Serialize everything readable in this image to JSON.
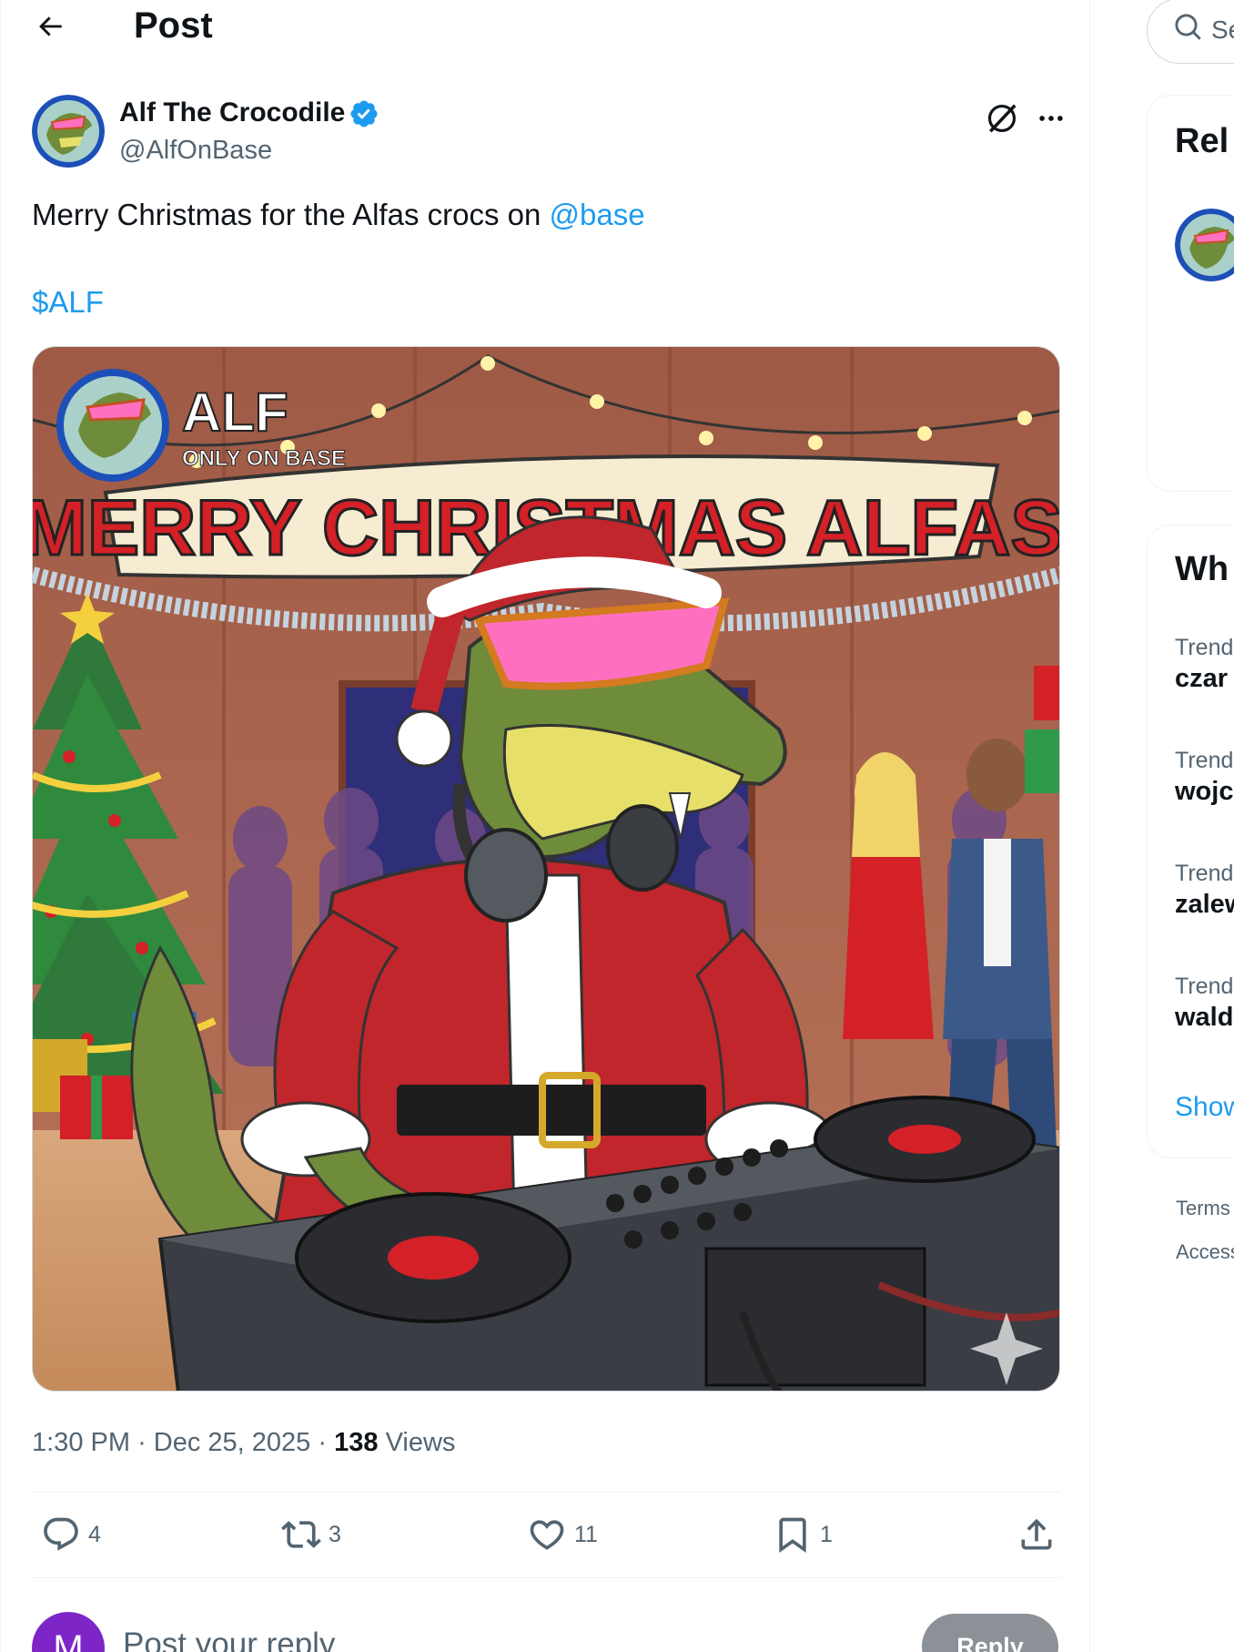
{
  "header": {
    "title": "Post"
  },
  "author": {
    "display_name": "Alf The Crocodile",
    "handle": "@AlfOnBase"
  },
  "post": {
    "text": "Merry Christmas for the Alfas crocs on ",
    "mention": "@base",
    "cashtag": "$ALF",
    "image": {
      "logo_title": "ALF",
      "logo_subtitle": "ONLY ON BASE",
      "banner": "MERRY CHRISTMAS ALFAS"
    },
    "time": "1:30 PM",
    "date": "Dec 25, 2025",
    "views_count": "138",
    "views_label": "Views",
    "separator": "·"
  },
  "actions": {
    "replies": "4",
    "reposts": "3",
    "likes": "11",
    "bookmarks": "1"
  },
  "reply": {
    "avatar_initial": "M",
    "placeholder": "Post your reply",
    "button": "Reply"
  },
  "sidebar": {
    "search_placeholder": "Se",
    "relevant_title": "Rel",
    "whats_title": "Wh",
    "trends": [
      {
        "label": "Trend",
        "name": "czar"
      },
      {
        "label": "Trend",
        "name": "wojc"
      },
      {
        "label": "Trend",
        "name": "zalew"
      },
      {
        "label": "Trend",
        "name": "wald"
      }
    ],
    "show_more": "Show",
    "footer": [
      "Terms",
      "Access"
    ]
  },
  "colors": {
    "link": "#1d9bf0",
    "verified": "#1d9bf0",
    "reply_avatar": "#7d25c7",
    "reply_button": "#8b9196"
  }
}
